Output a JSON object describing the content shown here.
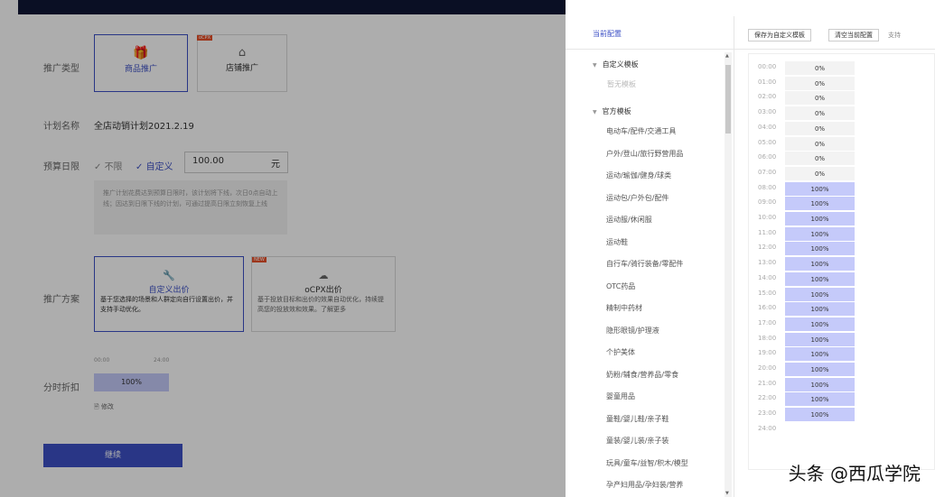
{
  "form": {
    "promo_type_label": "推广类型",
    "promo_types": [
      {
        "label": "商品推广",
        "icon": "gift-icon",
        "selected": true
      },
      {
        "label": "店铺推广",
        "icon": "shop-icon",
        "tag": "oCPX",
        "selected": false
      }
    ],
    "plan_name_label": "计划名称",
    "plan_name_value": "全店动销计划2021.2.19",
    "budget_label": "预算日限",
    "budget_options": [
      {
        "label": "不限",
        "selected": false
      },
      {
        "label": "自定义",
        "selected": true
      }
    ],
    "budget_value": "100.00",
    "budget_unit": "元",
    "budget_hint": "推广计划花费达到预算日限时，该计划将下线，次日0点自动上线；因达到日限下线的计划，可通过提高日限立刻恢复上线",
    "plan_label": "推广方案",
    "plan_options": [
      {
        "title": "自定义出价",
        "desc": "基于您选择的场景和人群定向自行设置出价，并支持手动优化。",
        "icon": "wrench-icon",
        "selected": true
      },
      {
        "title": "oCPX出价",
        "desc": "基于投放目标和出价的效果自动优化，持续提高您的投放效和效果。了解更多",
        "icon": "cloud-icon",
        "tag": "NEW",
        "selected": false
      }
    ],
    "time_label": "分时折扣",
    "time_start": "00:00",
    "time_end": "24:00",
    "time_value": "100%",
    "edit_label": "修改",
    "continue_label": "继续"
  },
  "drawer": {
    "current_config_label": "当前配置",
    "custom_template_title": "自定义模板",
    "no_template_label": "暂无模板",
    "official_template_title": "官方模板",
    "templates": [
      "电动车/配件/交通工具",
      "户外/登山/旅行野营用品",
      "运动/瑜伽/健身/球类",
      "运动包/户外包/配件",
      "运动服/休闲服",
      "运动鞋",
      "自行车/骑行装备/零配件",
      "OTC药品",
      "精制中药材",
      "隐形眼镜/护理液",
      "个护美体",
      "奶粉/辅食/营养品/零食",
      "婴童用品",
      "童鞋/婴儿鞋/亲子鞋",
      "童装/婴儿装/亲子装",
      "玩具/童车/益智/积木/模型",
      "孕产妇用品/孕妇装/营养"
    ],
    "save_template_button": "保存为自定义模板",
    "clear_config_button": "清空当前配置",
    "support_text": "支持",
    "hours": [
      "00:00",
      "01:00",
      "02:00",
      "03:00",
      "04:00",
      "05:00",
      "06:00",
      "07:00",
      "08:00",
      "09:00",
      "10:00",
      "11:00",
      "12:00",
      "13:00",
      "14:00",
      "15:00",
      "16:00",
      "17:00",
      "18:00",
      "19:00",
      "20:00",
      "21:00",
      "22:00",
      "23:00",
      "24:00"
    ],
    "values": [
      "0%",
      "0%",
      "0%",
      "0%",
      "0%",
      "0%",
      "0%",
      "0%",
      "100%",
      "100%",
      "100%",
      "100%",
      "100%",
      "100%",
      "100%",
      "100%",
      "100%",
      "100%",
      "100%",
      "100%",
      "100%",
      "100%",
      "100%",
      "100%"
    ]
  },
  "watermark": "头条 @西瓜学院",
  "colors": {
    "accent": "#3d50c6",
    "active_bar": "#c5cafa",
    "inactive_bar": "#f3f3f3",
    "topbar": "#0f1736",
    "tag": "#e8502a"
  }
}
